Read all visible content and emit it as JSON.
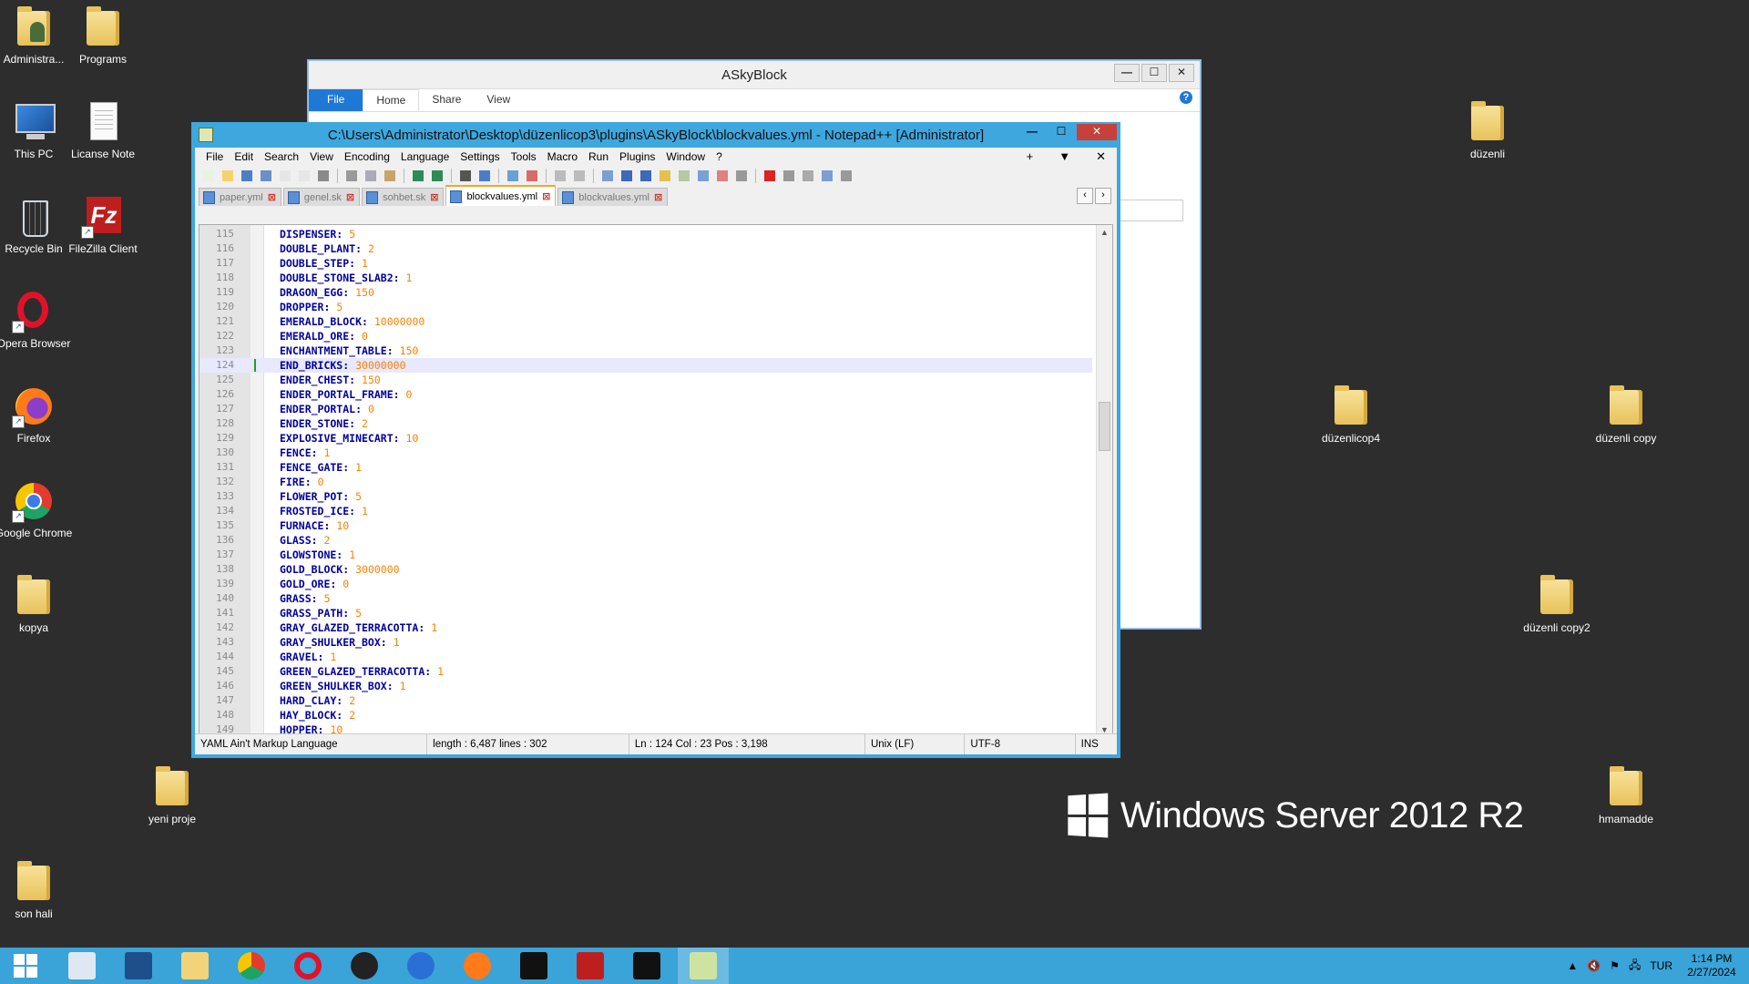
{
  "desktop": {
    "icons": [
      {
        "label": "Administra...",
        "kind": "user-folder"
      },
      {
        "label": "Programs",
        "kind": "folder"
      },
      {
        "label": "This PC",
        "kind": "pc"
      },
      {
        "label": "Licanse Note",
        "kind": "notepad"
      },
      {
        "label": "Recycle Bin",
        "kind": "bin"
      },
      {
        "label": "FileZilla Client",
        "kind": "filezilla"
      },
      {
        "label": "Opera Browser",
        "kind": "opera"
      },
      {
        "label": "Firefox",
        "kind": "firefox"
      },
      {
        "label": "Google Chrome",
        "kind": "chrome"
      },
      {
        "label": "kopya",
        "kind": "folder"
      },
      {
        "label": "yeni proje",
        "kind": "folder"
      },
      {
        "label": "son hali",
        "kind": "folder"
      },
      {
        "label": "düzenli",
        "kind": "folder"
      },
      {
        "label": "düzenlicop4",
        "kind": "folder"
      },
      {
        "label": "düzenli copy",
        "kind": "folder"
      },
      {
        "label": "düzenli copy2",
        "kind": "folder"
      },
      {
        "label": "hmamadde",
        "kind": "folder"
      }
    ],
    "branding": "Windows Server 2012 R2"
  },
  "explorer": {
    "title": "ASkyBlock",
    "tabs": [
      "File",
      "Home",
      "Share",
      "View"
    ]
  },
  "npp": {
    "title": "C:\\Users\\Administrator\\Desktop\\düzenlicop3\\plugins\\ASkyBlock\\blockvalues.yml - Notepad++ [Administrator]",
    "menu": [
      "File",
      "Edit",
      "Search",
      "View",
      "Encoding",
      "Language",
      "Settings",
      "Tools",
      "Macro",
      "Run",
      "Plugins",
      "Window",
      "?"
    ],
    "menu_right": [
      "+",
      "▼",
      "✕"
    ],
    "tabs": [
      {
        "label": "paper.yml",
        "active": false
      },
      {
        "label": "genel.sk",
        "active": false
      },
      {
        "label": "sohbet.sk",
        "active": false
      },
      {
        "label": "blockvalues.yml",
        "active": true
      },
      {
        "label": "blockvalues.yml",
        "active": false
      }
    ],
    "current_line": 124,
    "lines": [
      {
        "n": 115,
        "key": "DISPENSER:",
        "val": "5"
      },
      {
        "n": 116,
        "key": "DOUBLE_PLANT:",
        "val": "2"
      },
      {
        "n": 117,
        "key": "DOUBLE_STEP:",
        "val": "1"
      },
      {
        "n": 118,
        "key": "DOUBLE_STONE_SLAB2:",
        "val": "1"
      },
      {
        "n": 119,
        "key": "DRAGON_EGG:",
        "val": "150"
      },
      {
        "n": 120,
        "key": "DROPPER:",
        "val": "5"
      },
      {
        "n": 121,
        "key": "EMERALD_BLOCK:",
        "val": "10000000"
      },
      {
        "n": 122,
        "key": "EMERALD_ORE:",
        "val": "0"
      },
      {
        "n": 123,
        "key": "ENCHANTMENT_TABLE:",
        "val": "150"
      },
      {
        "n": 124,
        "key": "END_BRICKS:",
        "val": "30000000"
      },
      {
        "n": 125,
        "key": "ENDER_CHEST:",
        "val": "150"
      },
      {
        "n": 126,
        "key": "ENDER_PORTAL_FRAME:",
        "val": "0"
      },
      {
        "n": 127,
        "key": "ENDER_PORTAL:",
        "val": "0"
      },
      {
        "n": 128,
        "key": "ENDER_STONE:",
        "val": "2"
      },
      {
        "n": 129,
        "key": "EXPLOSIVE_MINECART:",
        "val": "10"
      },
      {
        "n": 130,
        "key": "FENCE:",
        "val": "1"
      },
      {
        "n": 131,
        "key": "FENCE_GATE:",
        "val": "1"
      },
      {
        "n": 132,
        "key": "FIRE:",
        "val": "0"
      },
      {
        "n": 133,
        "key": "FLOWER_POT:",
        "val": "5"
      },
      {
        "n": 134,
        "key": "FROSTED_ICE:",
        "val": "1"
      },
      {
        "n": 135,
        "key": "FURNACE:",
        "val": "10"
      },
      {
        "n": 136,
        "key": "GLASS:",
        "val": "2"
      },
      {
        "n": 137,
        "key": "GLOWSTONE:",
        "val": "1"
      },
      {
        "n": 138,
        "key": "GOLD_BLOCK:",
        "val": "3000000"
      },
      {
        "n": 139,
        "key": "GOLD_ORE:",
        "val": "0"
      },
      {
        "n": 140,
        "key": "GRASS:",
        "val": "5"
      },
      {
        "n": 141,
        "key": "GRASS_PATH:",
        "val": "5"
      },
      {
        "n": 142,
        "key": "GRAY_GLAZED_TERRACOTTA:",
        "val": "1"
      },
      {
        "n": 143,
        "key": "GRAY_SHULKER_BOX:",
        "val": "1"
      },
      {
        "n": 144,
        "key": "GRAVEL:",
        "val": "1"
      },
      {
        "n": 145,
        "key": "GREEN_GLAZED_TERRACOTTA:",
        "val": "1"
      },
      {
        "n": 146,
        "key": "GREEN_SHULKER_BOX:",
        "val": "1"
      },
      {
        "n": 147,
        "key": "HARD_CLAY:",
        "val": "2"
      },
      {
        "n": 148,
        "key": "HAY_BLOCK:",
        "val": "2"
      },
      {
        "n": 149,
        "key": "HOPPER:",
        "val": "10"
      }
    ],
    "status": {
      "language": "YAML Ain't Markup Language",
      "length": "length : 6,487    lines : 302",
      "position": "Ln : 124    Col : 23    Pos : 3,198",
      "eol": "Unix (LF)",
      "encoding": "UTF-8",
      "mode": "INS"
    }
  },
  "taskbar": {
    "apps": [
      "start",
      "server-manager",
      "powershell",
      "file-explorer",
      "chrome",
      "opera",
      "speedometer",
      "thunderbird",
      "firefox",
      "jetbrains-rider",
      "filezilla",
      "cmd",
      "notepadpp"
    ],
    "active": "notepadpp",
    "language": "TUR",
    "time": "1:14 PM",
    "date": "2/27/2024"
  }
}
